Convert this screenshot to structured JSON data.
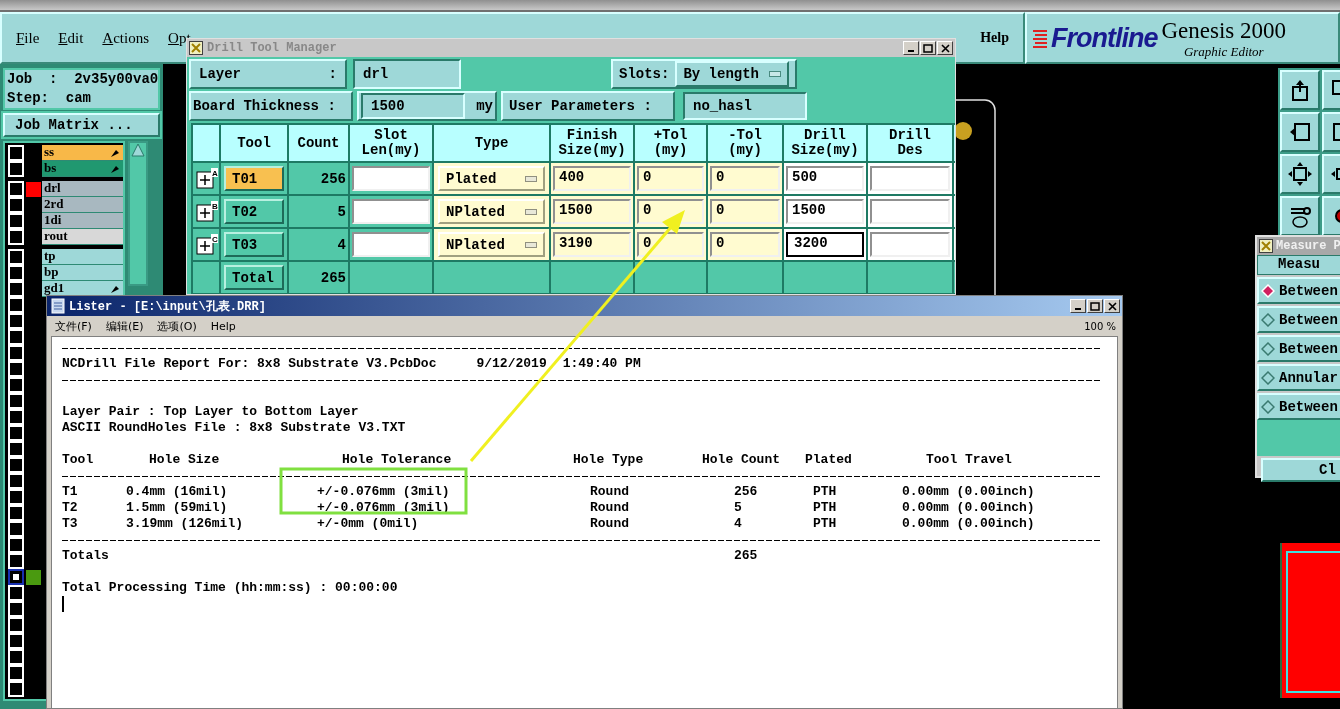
{
  "app": {
    "menu": [
      "File",
      "Edit",
      "Actions",
      "Opt"
    ],
    "help": "Help",
    "logo": {
      "brand": "Frontline",
      "product": "Genesis 2000",
      "subtitle": "Graphic Editor"
    }
  },
  "job_panel": {
    "job": "Job  :  2v35y00va0",
    "step": "Step:  cam",
    "button": "Job Matrix ..."
  },
  "layer_groups": [
    [
      {
        "name": "ss",
        "color": "#f8b848",
        "flag": true,
        "selected": false
      },
      {
        "name": "bs",
        "color": "#209870",
        "flag": true,
        "selected": false
      }
    ],
    [
      {
        "name": "drl",
        "color": "#a8b8c0",
        "flag": false,
        "tag": {
          "color": "#ff0000"
        },
        "selected": false
      },
      {
        "name": "2rd",
        "color": "#a8b8c0",
        "flag": false,
        "selected": false
      },
      {
        "name": "1di",
        "color": "#a8b8c0",
        "flag": false,
        "selected": false
      },
      {
        "name": "rout",
        "color": "#d8d8d8",
        "flag": false,
        "selected": false
      }
    ],
    [
      {
        "name": "tp",
        "color": "#9ed8d8",
        "flag": false,
        "selected": false
      },
      {
        "name": "bp",
        "color": "#9ed8d8",
        "flag": false,
        "selected": false
      },
      {
        "name": "gd1",
        "color": "#9ed8d8",
        "flag": true,
        "selected": false
      },
      {
        "selected": false
      },
      {
        "selected": false
      },
      {
        "selected": false
      },
      {
        "selected": false
      },
      {
        "selected": false
      },
      {
        "selected": false
      },
      {
        "selected": false
      },
      {
        "selected": false
      },
      {
        "selected": false
      },
      {
        "selected": false
      },
      {
        "selected": false
      },
      {
        "selected": false
      },
      {
        "selected": false
      },
      {
        "selected": false
      },
      {
        "selected": false
      },
      {
        "selected": false
      },
      {
        "selected": false
      },
      {
        "selected": true,
        "tag": {
          "color": "#4a9a10"
        }
      },
      {
        "selected": false
      },
      {
        "selected": false
      },
      {
        "selected": false
      },
      {
        "selected": false
      },
      {
        "selected": false
      },
      {
        "selected": false
      },
      {
        "selected": false
      }
    ]
  ],
  "drill_tool_manager": {
    "title": "Drill Tool Manager",
    "layer_label": "Layer",
    "layer_colon": ":",
    "layer_value": "drl",
    "slots_label": "Slots:",
    "slots_value": "By length",
    "thickness_label": "Board Thickness :",
    "thickness_value": "1500",
    "thickness_unit": "my",
    "user_params_label": "User Parameters :",
    "user_params_value": "no_hasl",
    "columns": [
      "Tool",
      "Count",
      "Slot\nLen(my)",
      "Type",
      "Finish\nSize(my)",
      "+Tol\n(my)",
      "-Tol\n(my)",
      "Drill\nSize(my)",
      "Drill\nDes"
    ],
    "tools": [
      {
        "letter": "A",
        "tool": "T01",
        "selected": true,
        "count": "256",
        "type": "Plated",
        "finish": "400",
        "plus_tol": "0",
        "minus_tol": "0",
        "drill_size": "500",
        "focused": false
      },
      {
        "letter": "B",
        "tool": "T02",
        "selected": false,
        "count": "5",
        "type": "NPlated",
        "finish": "1500",
        "plus_tol": "0",
        "minus_tol": "0",
        "drill_size": "1500",
        "focused": false
      },
      {
        "letter": "C",
        "tool": "T03",
        "selected": false,
        "count": "4",
        "type": "NPlated",
        "finish": "3190",
        "plus_tol": "0",
        "minus_tol": "0",
        "drill_size": "3200",
        "focused": true
      }
    ],
    "total": {
      "label": "Total",
      "count": "265"
    }
  },
  "lister": {
    "title": "Lister - [E:\\input\\孔表.DRR]",
    "menu": [
      "文件(F)",
      "编辑(E)",
      "选项(O)",
      "Help"
    ],
    "zoom": "100 %",
    "report_title": "NCDrill File Report For: 8x8 Substrate V3.PcbDoc",
    "report_date": "9/12/2019",
    "report_time": "1:49:40 PM",
    "layer_pair": "Layer Pair : Top Layer to Bottom Layer",
    "file_line": "ASCII RoundHoles File : 8x8 Substrate V3.TXT",
    "columns": [
      "Tool",
      "Hole Size",
      "Hole Tolerance",
      "Hole Type",
      "Hole Count",
      "Plated",
      "Tool Travel"
    ],
    "rows": [
      [
        "T1",
        "0.4mm (16mil)",
        "+/-0.076mm (3mil)",
        "Round",
        "256",
        "PTH",
        "0.00mm (0.00inch)"
      ],
      [
        "T2",
        "1.5mm (59mil)",
        "+/-0.076mm (3mil)",
        "Round",
        "5",
        "PTH",
        "0.00mm (0.00inch)"
      ],
      [
        "T3",
        "3.19mm (126mil)",
        "+/-0mm (0mil)",
        "Round",
        "4",
        "PTH",
        "0.00mm (0.00inch)"
      ]
    ],
    "totals_label": "Totals",
    "totals_count": "265",
    "processing_time": "Total Processing Time (hh:mm:ss) : 00:00:00"
  },
  "measure_popup": {
    "title": "Measure P",
    "header": "Measu",
    "options": [
      {
        "label": "Between",
        "selected": true
      },
      {
        "label": "Between",
        "selected": false
      },
      {
        "label": "Between",
        "selected": false
      },
      {
        "label": "Annular",
        "selected": false
      },
      {
        "label": "Between",
        "selected": false
      }
    ],
    "button": "Cl"
  }
}
